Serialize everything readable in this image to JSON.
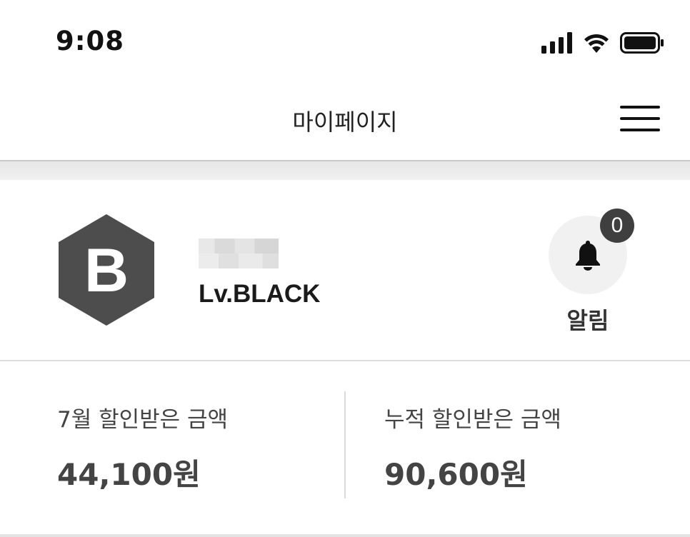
{
  "status_bar": {
    "time": "9:08",
    "icons": [
      "signal-icon",
      "wifi-icon",
      "battery-icon"
    ]
  },
  "header": {
    "title": "마이페이지",
    "menu_icon": "hamburger-menu-icon"
  },
  "profile": {
    "badge_letter": "B",
    "badge_color": "#4d4d4d",
    "level": "Lv.BLACK"
  },
  "alarm": {
    "count": "0",
    "label": "알림",
    "icon": "bell-icon"
  },
  "savings": {
    "monthly": {
      "label": "7월 할인받은 금액",
      "value": "44,100원"
    },
    "total": {
      "label": "누적 할인받은 금액",
      "value": "90,600원"
    }
  }
}
